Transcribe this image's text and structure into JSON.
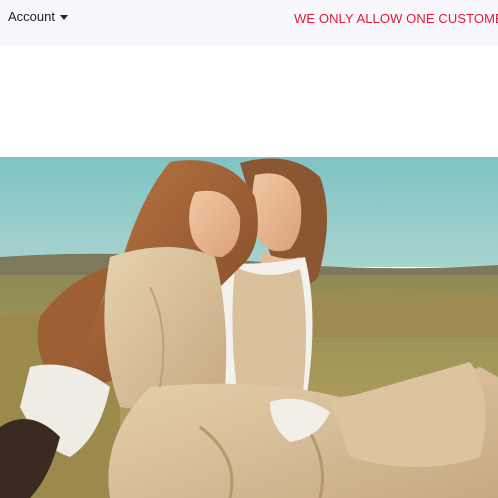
{
  "header": {
    "account_label": "Account",
    "announcement": "WE ONLY ALLOW ONE CUSTOME"
  },
  "icons": {
    "account_caret": "caret-down-icon"
  },
  "colors": {
    "topbar_bg": "#f8f7fb",
    "announcement_text": "#e0193a",
    "account_text": "#222222"
  }
}
